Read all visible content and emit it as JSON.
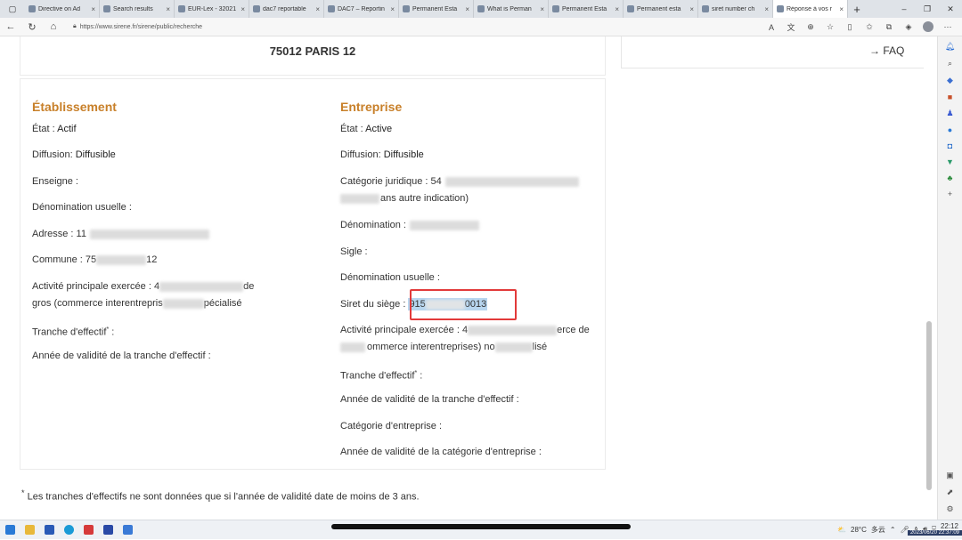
{
  "tabs": [
    {
      "label": "Directive on Ad",
      "active": false
    },
    {
      "label": "Search results",
      "active": false
    },
    {
      "label": "EUR-Lex - 32021",
      "active": false
    },
    {
      "label": "dac7 reportable",
      "active": false
    },
    {
      "label": "DAC7 – Reportin",
      "active": false
    },
    {
      "label": "Permanent Esta",
      "active": false
    },
    {
      "label": "What is Perman",
      "active": false
    },
    {
      "label": "Permanent Esta",
      "active": false
    },
    {
      "label": "Permanent esta",
      "active": false
    },
    {
      "label": "siret number ch",
      "active": false
    },
    {
      "label": "Réponse à vos r",
      "active": true
    }
  ],
  "addressbar": {
    "url": "https://www.sirene.fr/sirene/public/recherche"
  },
  "page": {
    "postal_header": "75012 PARIS 12",
    "faq_link": "→ FAQ",
    "etablissement": {
      "heading": "Établissement",
      "etat_label": "État :",
      "etat_value": "Actif",
      "diffusion_label": "Diffusion:",
      "diffusion_value": "Diffusible",
      "enseigne_label": "Enseigne :",
      "denomination_usuelle_label": "Dénomination usuelle :",
      "adresse_label": "Adresse : 11",
      "commune_label": "Commune : 75",
      "commune_suffix": "12",
      "activite_label": "Activité principale exercée : 4",
      "activite_suffix": "de",
      "activite_line2_prefix": "gros (commerce interentrepris",
      "activite_line2_suffix": "pécialisé",
      "tranche_label": "Tranche d'effectif",
      "tranche_sup": "*",
      "tranche_colon": " :",
      "annee_label": "Année de validité de la tranche d'effectif :"
    },
    "entreprise": {
      "heading": "Entreprise",
      "etat_label": "État :",
      "etat_value": "Active",
      "diffusion_label": "Diffusion:",
      "diffusion_value": "Diffusible",
      "categorie_juridique_label": "Catégorie juridique : 54",
      "categorie_juridique_line2": "ans autre indication)",
      "denomination_label": "Dénomination :",
      "sigle_label": "Sigle :",
      "denomination_usuelle_label": "Dénomination usuelle :",
      "siret_label": "Siret du siège :",
      "siret_prefix": "915",
      "siret_suffix": "0013",
      "activite_label": "Activité principale exercée : 4",
      "activite_suffix": "erce de",
      "activite_line2": "ommerce interentreprises) no",
      "activite_line2_suffix": "lisé",
      "tranche_label": "Tranche d'effectif",
      "tranche_sup": "*",
      "tranche_colon": " :",
      "annee_tranche_label": "Année de validité de la tranche d'effectif :",
      "categorie_entreprise_label": "Catégorie d'entreprise :",
      "annee_categorie_label": "Année de validité de la catégorie d'entreprise :"
    },
    "footnote_star": "*",
    "footnote": "Les tranches d'effectifs ne sont données que si l'année de validité date de moins de 3 ans."
  },
  "taskbar": {
    "weather": "28°C",
    "weather_desc": "多云",
    "time": "22:12",
    "timestamp_overlay": "2023/06/20 22:37:09"
  },
  "colors": {
    "heading_accent": "#c8802a",
    "highlight_box": "#e23a3a",
    "selection": "#b8d6ef"
  }
}
